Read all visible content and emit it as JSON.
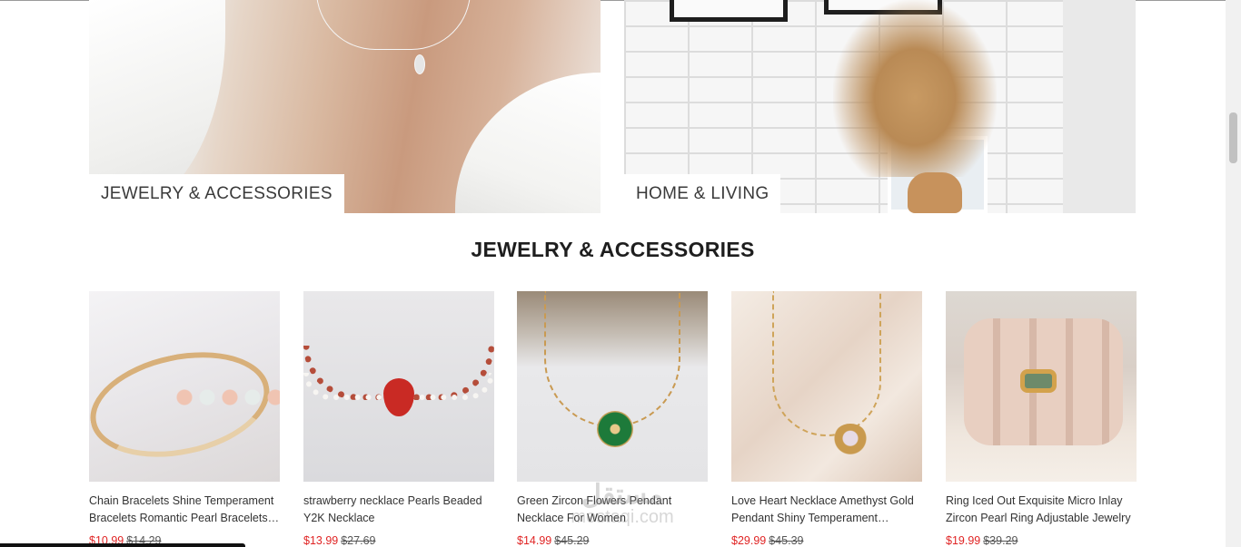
{
  "categories": [
    {
      "label": "JEWELRY & ACCESSORIES"
    },
    {
      "label": "HOME & LIVING"
    }
  ],
  "section_title": "JEWELRY & ACCESSORIES",
  "products": [
    {
      "name": "Chain Bracelets Shine Temperament Bracelets Romantic Pearl Bracelets…",
      "price": "$10.99",
      "old_price": "$14.29"
    },
    {
      "name": "strawberry necklace Pearls Beaded Y2K Necklace",
      "price": "$13.99",
      "old_price": "$27.69"
    },
    {
      "name": "Green Zircon Flowers Pendant Necklace For Women",
      "price": "$14.99",
      "old_price": "$45.29"
    },
    {
      "name": "Love Heart Necklace Amethyst Gold Pendant Shiny Temperament…",
      "price": "$29.99",
      "old_price": "$45.39"
    },
    {
      "name": "Ring Iced Out Exquisite Micro Inlay Zircon Pearl Ring Adjustable Jewelry",
      "price": "$19.99",
      "old_price": "$39.29"
    }
  ],
  "watermark": {
    "line1": "مستقل",
    "line2": "mostaqi.com"
  },
  "colors": {
    "sale_price": "#e02424",
    "old_price": "#555555"
  }
}
